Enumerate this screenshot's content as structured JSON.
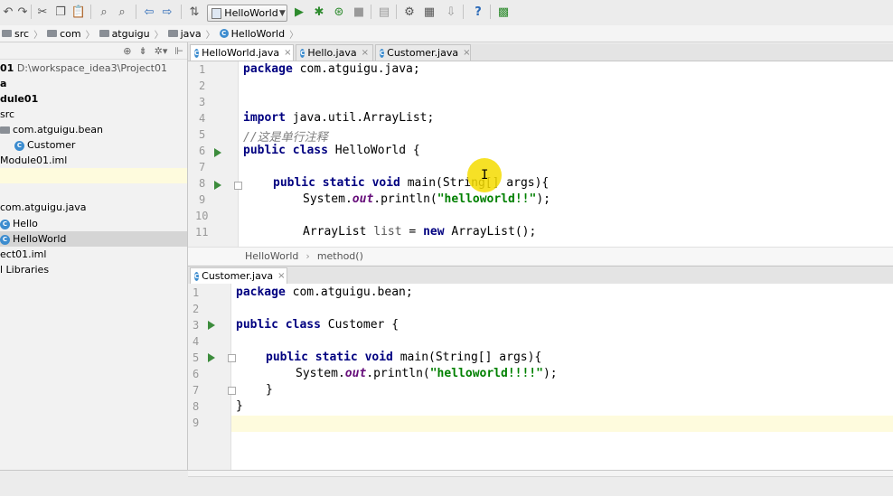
{
  "toolbar": {
    "run_config": "HelloWorld",
    "buttons": [
      "undo-icon",
      "redo-icon",
      "cut-icon",
      "copy-icon",
      "paste-icon",
      "find-icon",
      "replace-icon",
      "back-icon",
      "forward-icon",
      "build-icon",
      "run-icon",
      "debug-icon",
      "coverage-icon",
      "stop-icon",
      "sdk-icon",
      "settings-icon",
      "project-structure-icon",
      "vcs-icon",
      "help-icon",
      "profile-icon"
    ]
  },
  "navbar": {
    "crumbs": [
      "src",
      "com",
      "atguigu",
      "java",
      "HelloWorld"
    ]
  },
  "project_tree": {
    "rows": [
      {
        "label": "01",
        "path": "D:\\workspace_idea3\\Project01",
        "bold": true
      },
      {
        "label": "a",
        "bold": true
      },
      {
        "label": "dule01",
        "bold": true
      },
      {
        "label": "src"
      },
      {
        "label": "com.atguigu.bean",
        "icon": "package"
      },
      {
        "label": "Customer",
        "icon": "class"
      },
      {
        "label": "Module01.iml"
      },
      {
        "label": ""
      },
      {
        "label": ""
      },
      {
        "label": "com.atguigu.java"
      },
      {
        "label": "Hello",
        "icon": "class"
      },
      {
        "label": "HelloWorld",
        "icon": "class",
        "selected": true
      },
      {
        "label": "ect01.iml"
      },
      {
        "label": "l Libraries"
      }
    ]
  },
  "top_editor": {
    "tabs": [
      {
        "label": "HelloWorld.java",
        "active": true
      },
      {
        "label": "Hello.java",
        "active": false
      },
      {
        "label": "Customer.java",
        "active": false
      }
    ],
    "line_numbers": [
      "1",
      "2",
      "3",
      "4",
      "5",
      "6",
      "7",
      "8",
      "9",
      "10",
      "11"
    ],
    "code": {
      "l1_kw": "package",
      "l1_rest": " com.atguigu.java;",
      "l4_kw": "import",
      "l4_rest": " java.util.ArrayList;",
      "l5_comment": "//这是单行注释",
      "l6_kw": "public class",
      "l6_rest": " HelloWorld {",
      "l8_kw": "public static void",
      "l8_rest": " main(String[] args){",
      "l9_a": "System.",
      "l9_field": "out",
      "l9_b": ".println(",
      "l9_str": "\"helloworld!!\"",
      "l9_c": ");",
      "l11_a": "ArrayList ",
      "l11_var": "list",
      "l11_b": " = ",
      "l11_kw": "new",
      "l11_c": " ArrayList();"
    },
    "breadcrumb_class": "HelloWorld",
    "breadcrumb_method": "method()"
  },
  "bottom_editor": {
    "tab": "Customer.java",
    "line_numbers": [
      "1",
      "2",
      "3",
      "4",
      "5",
      "6",
      "7",
      "8",
      "9"
    ],
    "code": {
      "l1_kw": "package",
      "l1_rest": " com.atguigu.bean;",
      "l3_kw": "public class",
      "l3_rest": " Customer {",
      "l5_kw": "public static void",
      "l5_rest": " main(String[] args){",
      "l6_a": "System.",
      "l6_field": "out",
      "l6_b": ".println(",
      "l6_str": "\"helloworld!!!!\"",
      "l6_c": ");",
      "l7": "}",
      "l8": "}"
    }
  }
}
